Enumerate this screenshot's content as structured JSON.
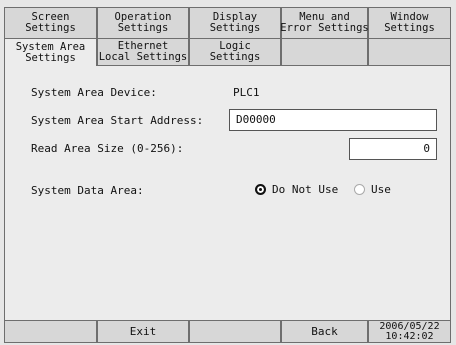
{
  "tabs_row1": [
    "Screen\nSettings",
    "Operation\nSettings",
    "Display\nSettings",
    "Menu and\nError Settings",
    "Window\nSettings"
  ],
  "tabs_row2": [
    "System Area\nSettings",
    "Ethernet\nLocal Settings",
    "Logic\nSettings",
    "",
    ""
  ],
  "form": {
    "device_label": "System Area Device:",
    "device_value": "PLC1",
    "start_label": "System Area Start Address:",
    "start_value": "D00000",
    "size_label": "Read Area Size (0-256):",
    "size_value": "0",
    "data_area_label": "System Data Area:",
    "opt_do_not_use": "Do Not Use",
    "opt_use": "Use"
  },
  "bottom": {
    "exit_label": "Exit",
    "back_label": "Back",
    "date": "2006/05/22",
    "time": "10:42:02"
  }
}
